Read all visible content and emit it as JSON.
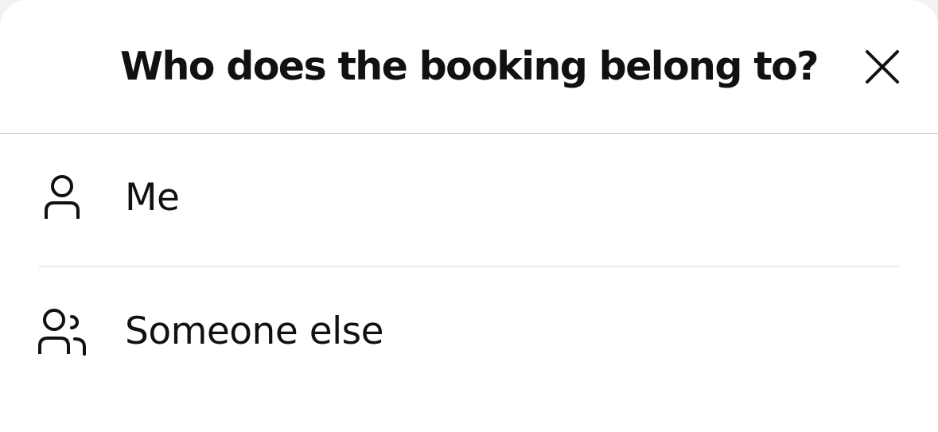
{
  "dialog": {
    "title": "Who does the booking belong to?",
    "close_icon": "close-icon"
  },
  "options": [
    {
      "label": "Me",
      "icon": "person-icon"
    },
    {
      "label": "Someone else",
      "icon": "people-icon"
    }
  ],
  "colors": {
    "text": "#111111",
    "background": "#ffffff",
    "divider": "#c6c6c6"
  }
}
